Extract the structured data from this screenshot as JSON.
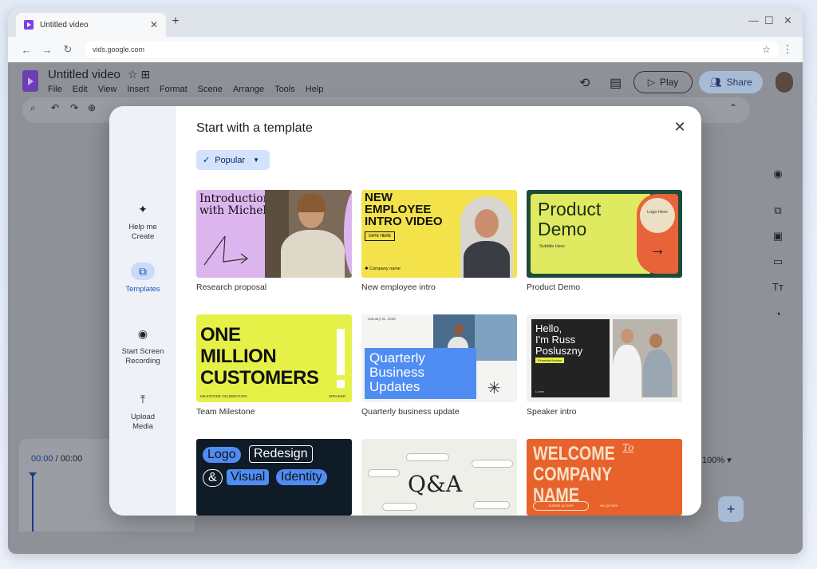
{
  "browser": {
    "tab_title": "Untitled video",
    "tab_close": "✕",
    "new_tab": "+",
    "url": "vids.google.com",
    "nav_back": "←",
    "nav_forward": "→",
    "nav_reload": "↻",
    "bookmark_star": "☆",
    "menu_kebab": "⋮",
    "window_min": "—",
    "window_max": "☐",
    "window_close": "✕"
  },
  "app": {
    "doc_title": "Untitled video",
    "title_icons": "☆ ⊞",
    "menu": [
      "File",
      "Edit",
      "View",
      "Insert",
      "Format",
      "Scene",
      "Arrange",
      "Tools",
      "Help"
    ],
    "play_label": "Play",
    "share_label": "Share",
    "timecode_current": "00:00",
    "timecode_total": " / 00:00",
    "zoom": "100%",
    "add_symbol": "+"
  },
  "modal": {
    "title": "Start with a template",
    "close": "✕",
    "filter_chip": "Popular",
    "sidebar": [
      {
        "label1": "Help me",
        "label2": "Create",
        "icon": "✦"
      },
      {
        "label1": "Templates",
        "label2": "",
        "icon": "⧉"
      },
      {
        "label1": "Start Screen",
        "label2": "Recording",
        "icon": "◉"
      },
      {
        "label1": "Upload",
        "label2": "Media",
        "icon": "⤒"
      }
    ],
    "templates": [
      {
        "caption": "Research proposal",
        "title_line1": "Introduction",
        "title_line2": "with Michelle"
      },
      {
        "caption": "New employee intro",
        "title_line1": "NEW",
        "title_line2": "EMPLOYEE",
        "title_line3": "INTRO VIDEO",
        "tag": "DATE HERE",
        "company": "Company name"
      },
      {
        "caption": "Product Demo",
        "title_line1": "Product",
        "title_line2": "Demo",
        "subtitle": "Subtitle Here",
        "logo": "Logo Here"
      },
      {
        "caption": "Team Milestone",
        "title_line1": "ONE",
        "title_line2": "MILLION",
        "title_line3": "CUSTOMERS",
        "footer_left": "MILESTONE CELEBRATION",
        "footer_right": "SPEAKER"
      },
      {
        "caption": "Quarterly business update",
        "title_line1": "Quarterly",
        "title_line2": "Business",
        "title_line3": "Updates",
        "date": "January 31, 2025"
      },
      {
        "caption": "Speaker intro",
        "title_line1": "Hello,",
        "title_line2": "I'm Russ",
        "title_line3": "Posluszny",
        "tag": "Financial Advisor",
        "name": "Lorem"
      },
      {
        "caption": "",
        "words": [
          "Logo",
          "Redesign",
          "&",
          "Visual",
          "Identity"
        ]
      },
      {
        "caption": "",
        "title": "Q&A"
      },
      {
        "caption": "",
        "title_line1": "WELCOME",
        "title_line2": "COMPANY NAME",
        "to": "To",
        "subtitle": "Subtitle go here",
        "note": "etc go here"
      }
    ]
  }
}
